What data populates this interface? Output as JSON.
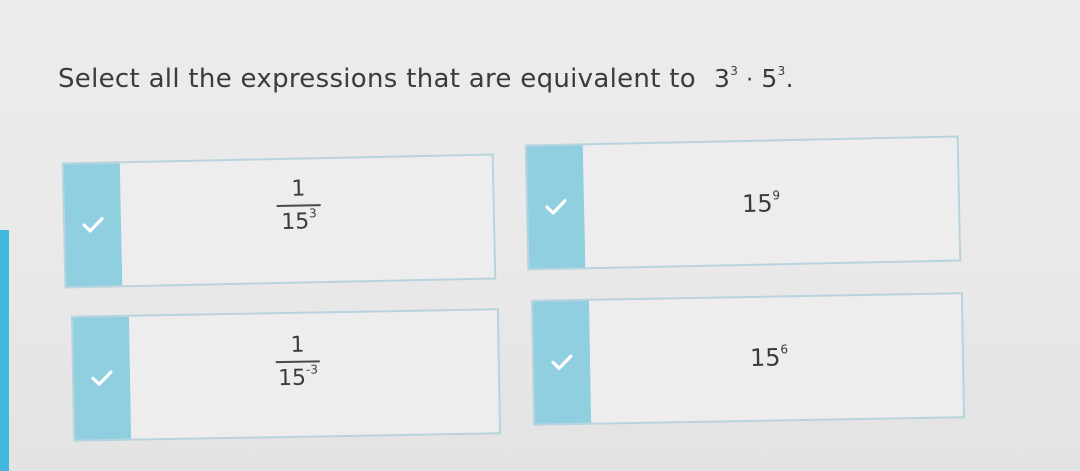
{
  "question": {
    "prompt": "Select all the expressions that are equivalent to",
    "expression": {
      "base1": "3",
      "exp1": "3",
      "operator": "·",
      "base2": "5",
      "exp2": "3",
      "end": "."
    }
  },
  "choices": [
    {
      "id": "a",
      "type": "fraction",
      "numerator": "1",
      "base": "15",
      "exponent": "3",
      "selected": true
    },
    {
      "id": "b",
      "type": "power",
      "base": "15",
      "exponent": "9",
      "selected": true
    },
    {
      "id": "c",
      "type": "fraction",
      "numerator": "1",
      "base": "15",
      "exponent": "-3",
      "selected": true
    },
    {
      "id": "d",
      "type": "power",
      "base": "15",
      "exponent": "6",
      "selected": true
    }
  ],
  "colors": {
    "accent": "#8fcfe0",
    "edge": "#43b6dc",
    "check": "#ffffff"
  },
  "icons": {
    "check": "check-icon"
  }
}
